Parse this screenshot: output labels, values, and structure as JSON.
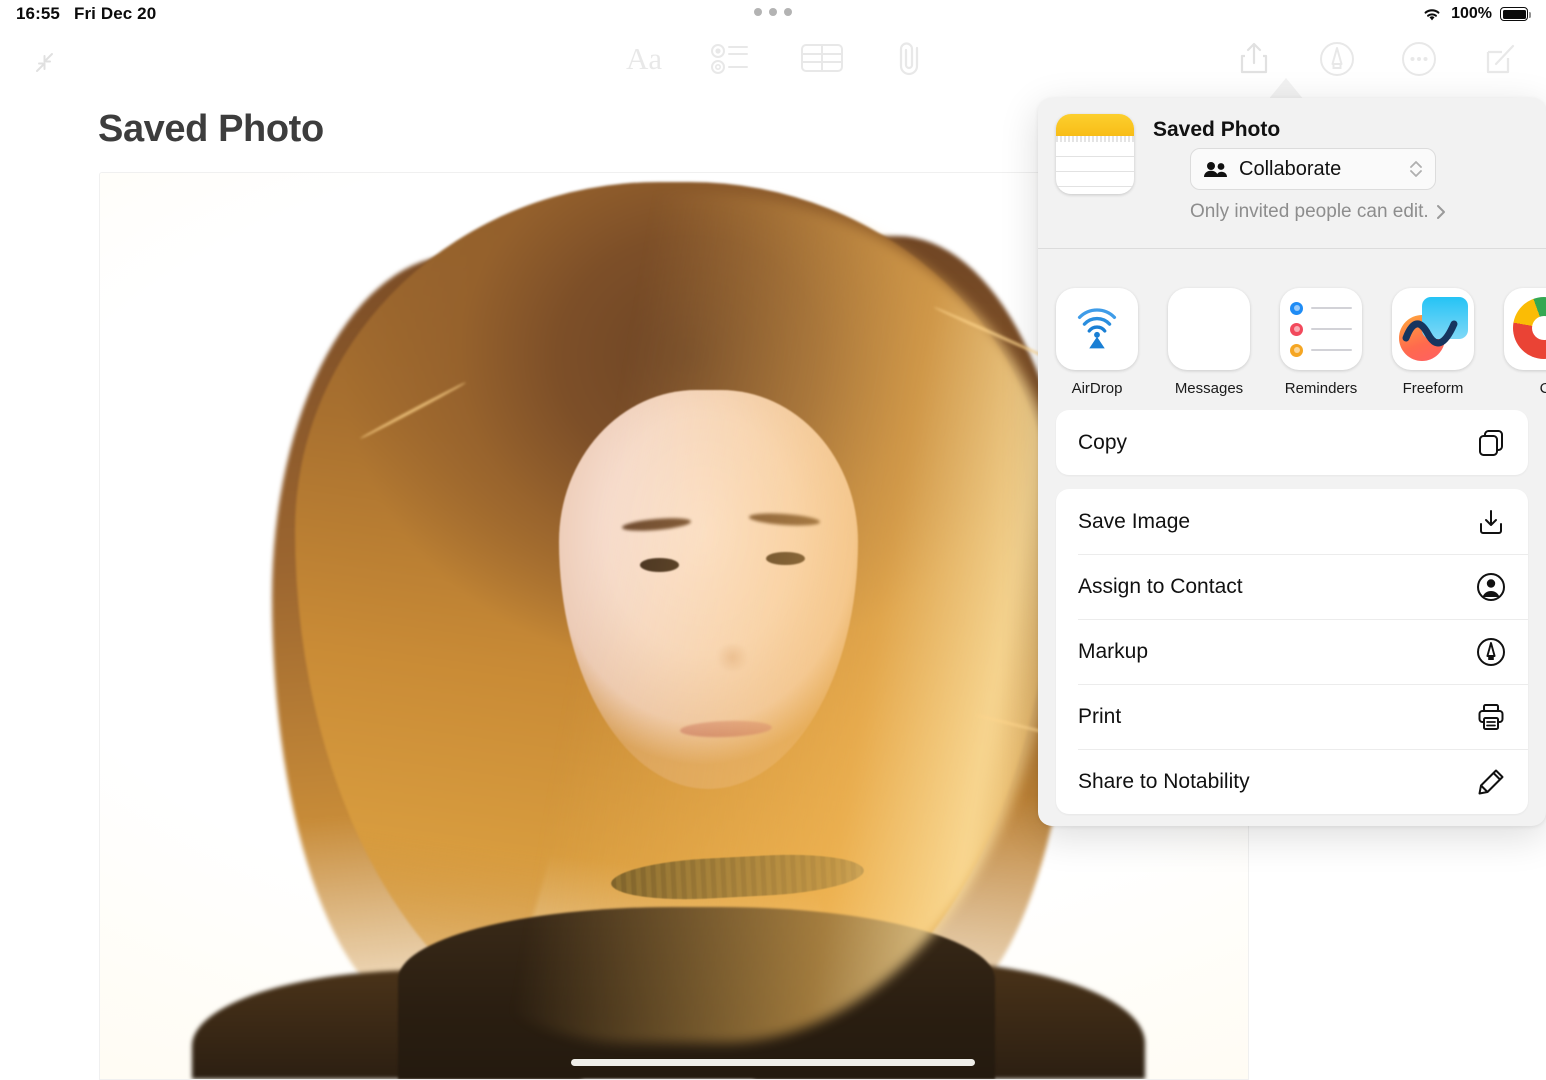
{
  "status_bar": {
    "time": "16:55",
    "date": "Fri Dec 20",
    "battery_percent": "100%",
    "wifi_icon": "wifi-icon",
    "battery_icon": "battery-full-icon",
    "multitask_handle": "multitasking-dots"
  },
  "toolbar": {
    "collapse_icon": "collapse-arrows-icon",
    "format_label": "Aa",
    "checklist_icon": "checklist-icon",
    "table_icon": "table-icon",
    "attachment_icon": "paperclip-icon",
    "share_icon": "share-icon",
    "markup_icon": "markup-pen-icon",
    "more_icon": "more-ellipsis-icon",
    "compose_icon": "compose-icon"
  },
  "note": {
    "title": "Saved Photo",
    "photo_alt": "backlit portrait of a young woman with long auburn hair"
  },
  "share_sheet": {
    "app_icon": "notes-app-icon",
    "title": "Saved Photo",
    "collaborate": {
      "label": "Collaborate",
      "people_icon": "people-icon",
      "stepper_icon": "chevron-up-down-icon"
    },
    "permission_text": "Only invited people can edit.",
    "permission_chevron": "chevron-right-icon",
    "apps": [
      {
        "name": "AirDrop",
        "icon": "airdrop-icon"
      },
      {
        "name": "Messages",
        "icon": "messages-icon"
      },
      {
        "name": "Reminders",
        "icon": "reminders-icon"
      },
      {
        "name": "Freeform",
        "icon": "freeform-icon"
      },
      {
        "name": "C",
        "icon": "chrome-icon"
      }
    ],
    "actions_primary": [
      {
        "label": "Copy",
        "icon": "copy-icon"
      }
    ],
    "actions_secondary": [
      {
        "label": "Save Image",
        "icon": "save-image-icon"
      },
      {
        "label": "Assign to Contact",
        "icon": "contact-icon"
      },
      {
        "label": "Markup",
        "icon": "markup-pen-icon"
      },
      {
        "label": "Print",
        "icon": "printer-icon"
      },
      {
        "label": "Share to Notability",
        "icon": "pencil-icon"
      }
    ]
  },
  "home_indicator": "home-indicator",
  "colors": {
    "notes_yellow": "#f8bd17",
    "messages_green": "#1fc93a",
    "airdrop_blue": "#1a7fd4",
    "popover_bg": "#f2f2f2",
    "card_bg": "#ffffff"
  }
}
